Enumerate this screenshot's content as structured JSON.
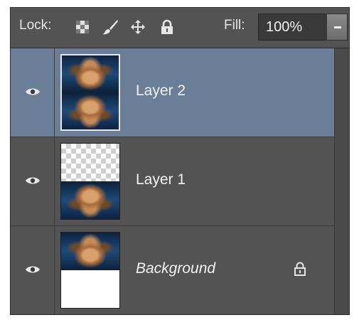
{
  "toolbar": {
    "lock_label": "Lock:",
    "lock_icons": [
      "lock-transparent-pixels-icon",
      "lock-image-pixels-icon",
      "lock-position-icon",
      "lock-all-icon"
    ],
    "fill_label": "Fill:",
    "fill_value": "100%"
  },
  "layers": [
    {
      "name": "Layer 2",
      "selected": true,
      "visible": true,
      "locked": false
    },
    {
      "name": "Layer 1",
      "selected": false,
      "visible": true,
      "locked": false
    },
    {
      "name": "Background",
      "selected": false,
      "visible": true,
      "locked": true
    }
  ],
  "colors": {
    "panel_bg": "#535353",
    "selected_row": "#6b7e98",
    "text": "#f2f2f2"
  }
}
